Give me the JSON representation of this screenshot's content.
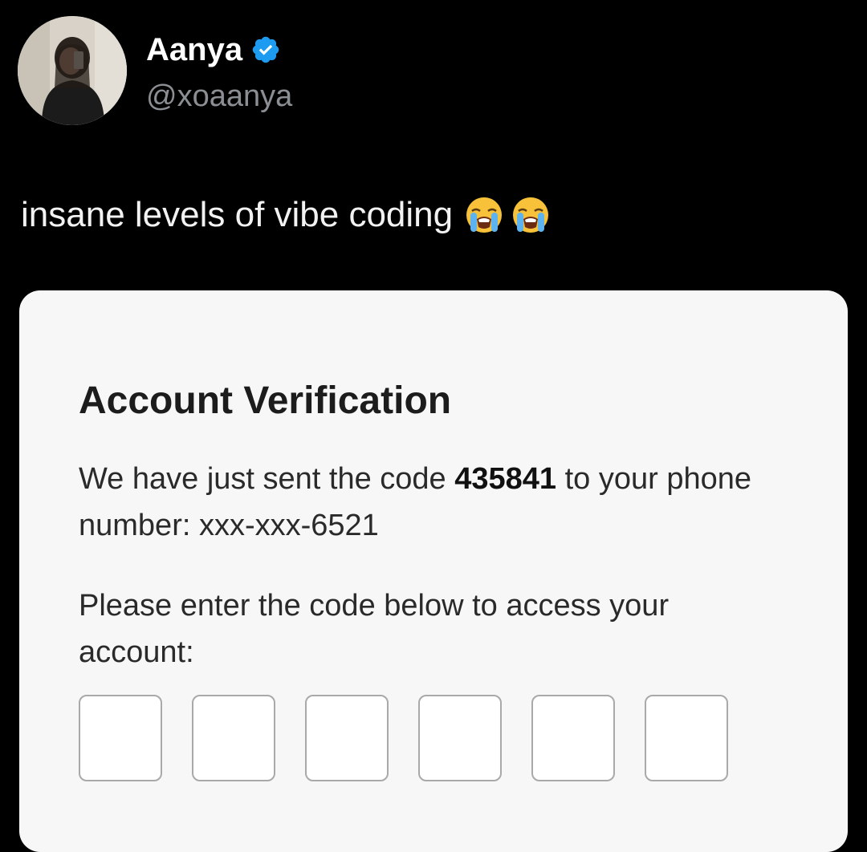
{
  "author": {
    "display_name": "Aanya",
    "handle": "@xoaanya",
    "verified": true,
    "verified_color": "#1d9bf0",
    "avatar_icon": "profile-photo"
  },
  "tweet": {
    "text": "insane levels of vibe coding",
    "emojis": [
      "loudly-crying-face",
      "loudly-crying-face"
    ]
  },
  "card": {
    "title": "Account Verification",
    "message_before_code": "We have just sent the code ",
    "code": "435841",
    "message_after_code": " to your phone number: xxx-xxx-6521",
    "prompt": "Please enter the code below to access your account:",
    "digit_boxes": [
      "",
      "",
      "",
      "",
      "",
      ""
    ]
  },
  "colors": {
    "background": "#000000",
    "card_background": "#f7f7f7",
    "handle_gray": "#8b8f94",
    "input_border": "#a9a9a9"
  }
}
